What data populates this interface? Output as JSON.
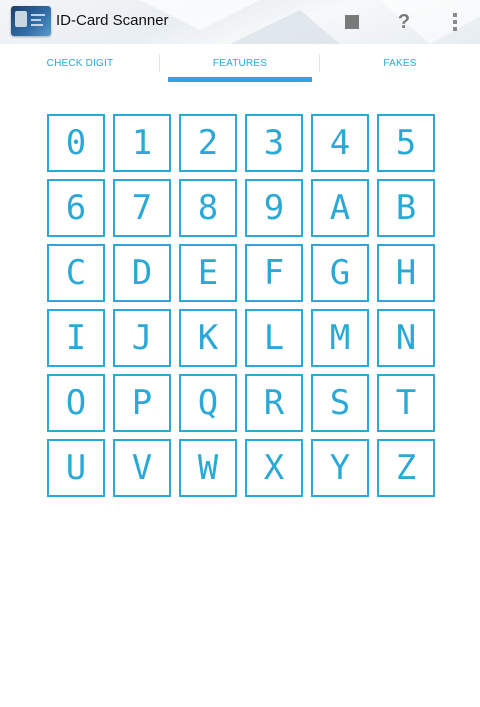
{
  "app_bar": {
    "title": "ID-Card Scanner",
    "logo_icon": "id-card-icon",
    "actions": [
      {
        "name": "stop",
        "icon": "stop-icon"
      },
      {
        "name": "help",
        "icon": "help-icon",
        "glyph": "?"
      },
      {
        "name": "more",
        "icon": "overflow-menu-icon"
      }
    ]
  },
  "tabs": [
    {
      "label": "CHECK DIGIT",
      "active": false
    },
    {
      "label": "FEATURES",
      "active": true
    },
    {
      "label": "FAKES",
      "active": false
    }
  ],
  "characters": [
    "0",
    "1",
    "2",
    "3",
    "4",
    "5",
    "6",
    "7",
    "8",
    "9",
    "A",
    "B",
    "C",
    "D",
    "E",
    "F",
    "G",
    "H",
    "I",
    "J",
    "K",
    "L",
    "M",
    "N",
    "O",
    "P",
    "Q",
    "R",
    "S",
    "T",
    "U",
    "V",
    "W",
    "X",
    "Y",
    "Z"
  ],
  "colors": {
    "accent": "#2aa9d8",
    "title_text": "#111111",
    "action_icon": "#7a7a7a"
  }
}
